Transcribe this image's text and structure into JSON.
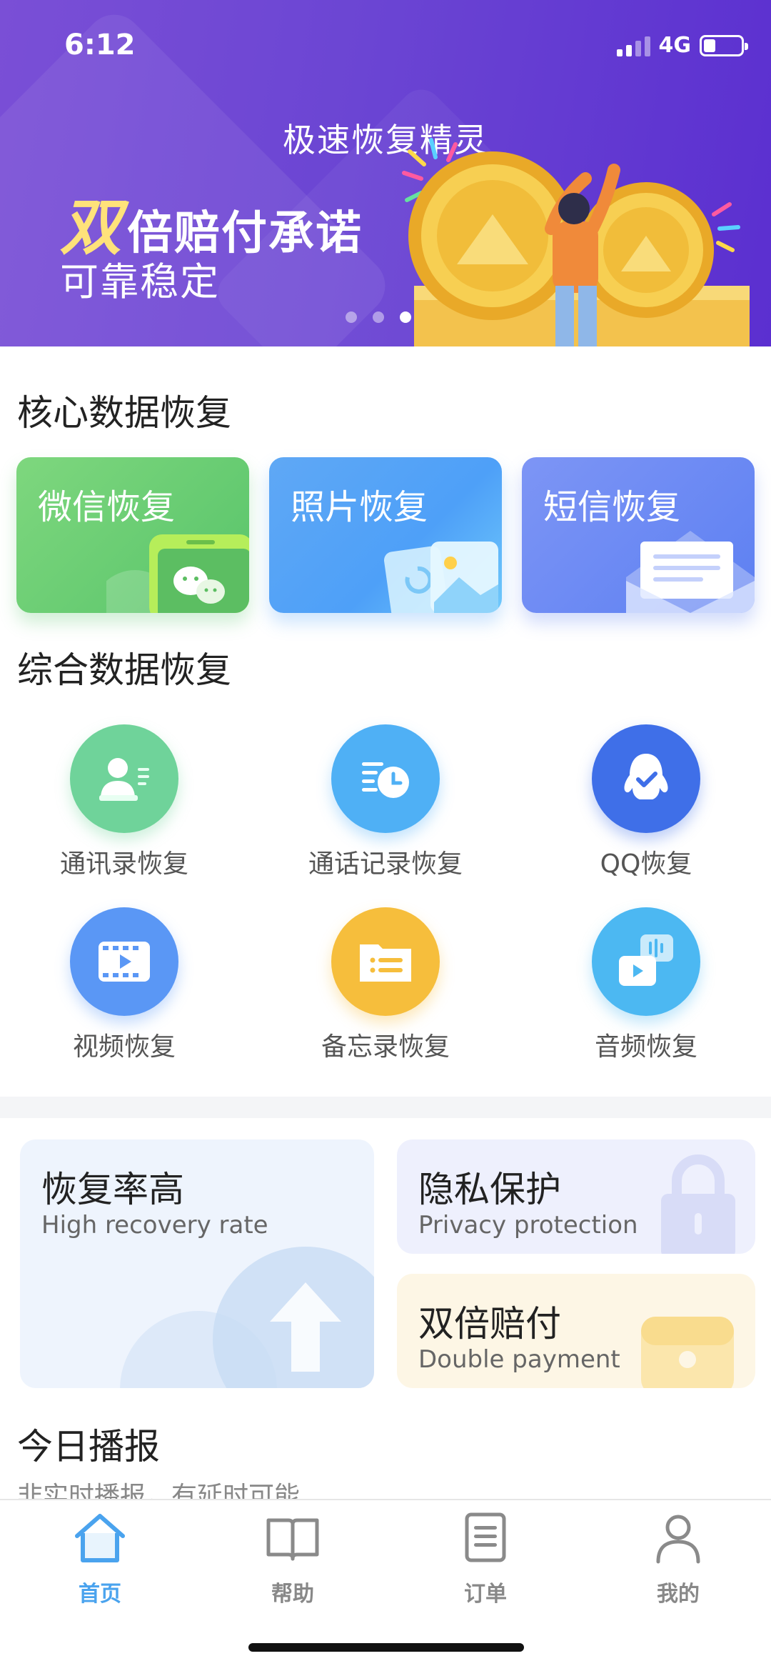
{
  "status_bar": {
    "time": "6:12",
    "network": "4G"
  },
  "banner": {
    "title": "极速恢复精灵",
    "headline_accent": "双",
    "headline_rest": "倍赔付承诺",
    "subline": "可靠稳定",
    "carousel_active_index": 2
  },
  "core_section": {
    "title": "核心数据恢复",
    "cards": [
      {
        "label": "微信恢复",
        "icon": "wechat-phone-icon",
        "color": "#5fc56c"
      },
      {
        "label": "照片恢复",
        "icon": "photo-restore-icon",
        "color": "#4ea0f8"
      },
      {
        "label": "短信恢复",
        "icon": "envelope-icon",
        "color": "#6483f2"
      }
    ]
  },
  "general_section": {
    "title": "综合数据恢复",
    "items": [
      {
        "label": "通讯录恢复",
        "icon": "contact-card-icon",
        "color": "#6fd39a"
      },
      {
        "label": "通话记录恢复",
        "icon": "call-log-clock-icon",
        "color": "#4fb0f5"
      },
      {
        "label": "QQ恢复",
        "icon": "qq-penguin-icon",
        "color": "#3f6fe8"
      },
      {
        "label": "视频恢复",
        "icon": "video-film-icon",
        "color": "#5a97f5"
      },
      {
        "label": "备忘录恢复",
        "icon": "folder-list-icon",
        "color": "#f6be3c"
      },
      {
        "label": "音频恢复",
        "icon": "audio-wave-icon",
        "color": "#4cb8f2"
      }
    ]
  },
  "features": {
    "high_rate": {
      "title": "恢复率高",
      "subtitle": "High recovery rate",
      "icon": "upload-arrow-icon"
    },
    "privacy": {
      "title": "隐私保护",
      "subtitle": "Privacy protection",
      "icon": "lock-icon"
    },
    "double": {
      "title": "双倍赔付",
      "subtitle": "Double payment",
      "icon": "wallet-icon"
    }
  },
  "today": {
    "title": "今日播报",
    "subtitle": "非实时播报，有延时可能"
  },
  "tabbar": {
    "tabs": [
      {
        "label": "首页",
        "icon": "home-icon",
        "active": true
      },
      {
        "label": "帮助",
        "icon": "book-icon",
        "active": false
      },
      {
        "label": "订单",
        "icon": "list-doc-icon",
        "active": false
      },
      {
        "label": "我的",
        "icon": "user-icon",
        "active": false
      }
    ]
  },
  "colors": {
    "accent": "#4aa3ee",
    "banner": "#6b45d3",
    "headline_accent": "#ffe27a"
  }
}
